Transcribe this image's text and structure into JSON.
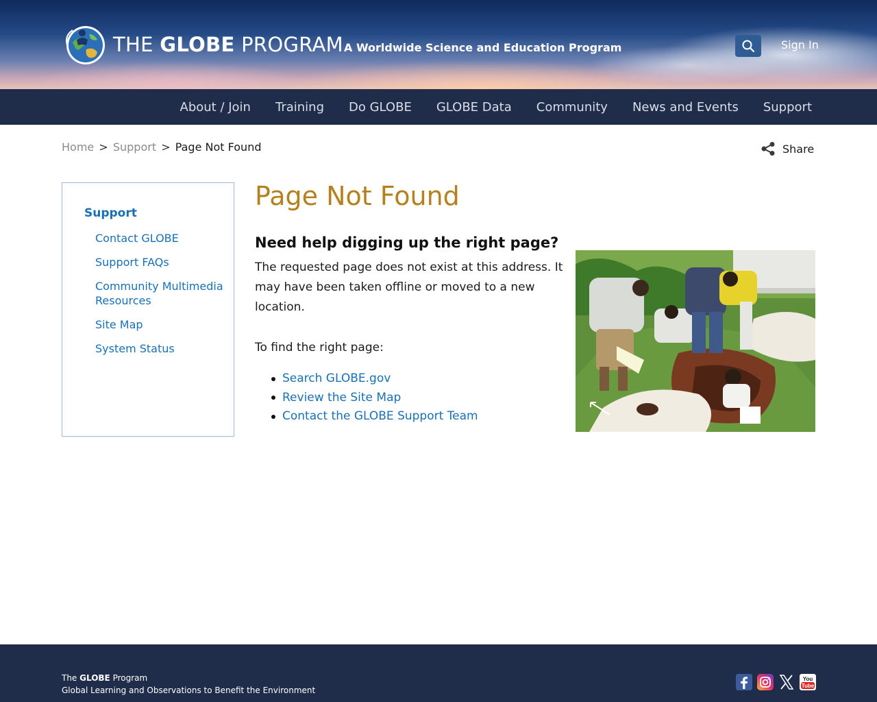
{
  "header": {
    "brand_prefix": "THE ",
    "brand_bold": "GLOBE",
    "brand_suffix": " PROGRAM",
    "tagline": "A Worldwide Science and Education Program",
    "search_icon": "search-icon",
    "sign_in": "Sign In"
  },
  "nav": {
    "items": [
      {
        "label": "About / Join"
      },
      {
        "label": "Training"
      },
      {
        "label": "Do GLOBE"
      },
      {
        "label": "GLOBE Data"
      },
      {
        "label": "Community"
      },
      {
        "label": "News and Events"
      },
      {
        "label": "Support"
      }
    ]
  },
  "breadcrumb": {
    "home": "Home",
    "sep": ">",
    "support": "Support",
    "current": "Page Not Found"
  },
  "share": {
    "label": "Share",
    "icon": "share-icon"
  },
  "sidebar": {
    "title": "Support",
    "items": [
      {
        "label": "Contact GLOBE"
      },
      {
        "label": "Support FAQs"
      },
      {
        "label": "Community Multimedia Resources"
      },
      {
        "label": "Site Map"
      },
      {
        "label": "System Status"
      }
    ]
  },
  "main": {
    "title": "Page Not Found",
    "subheading": "Need help digging up the right page?",
    "body": "The requested page does not exist at this address. It may have been taken offline or moved to a new  location.",
    "find_text": "To find the right page:",
    "links": [
      {
        "label": "Search GLOBE.gov"
      },
      {
        "label": "Review the Site Map"
      },
      {
        "label": "Contact the GLOBE Support Team"
      }
    ]
  },
  "footer": {
    "name_prefix": "The ",
    "name_bold": "GLOBE",
    "name_suffix": " Program",
    "description": "Global Learning and Observations to Benefit the Environment",
    "socials": [
      "facebook-icon",
      "instagram-icon",
      "x-icon",
      "youtube-icon"
    ]
  },
  "colors": {
    "nav_bg": "#1f2d4a",
    "title_gold": "#b5811e",
    "link_blue": "#1a6fb5",
    "search_btn": "#2f5d93"
  }
}
